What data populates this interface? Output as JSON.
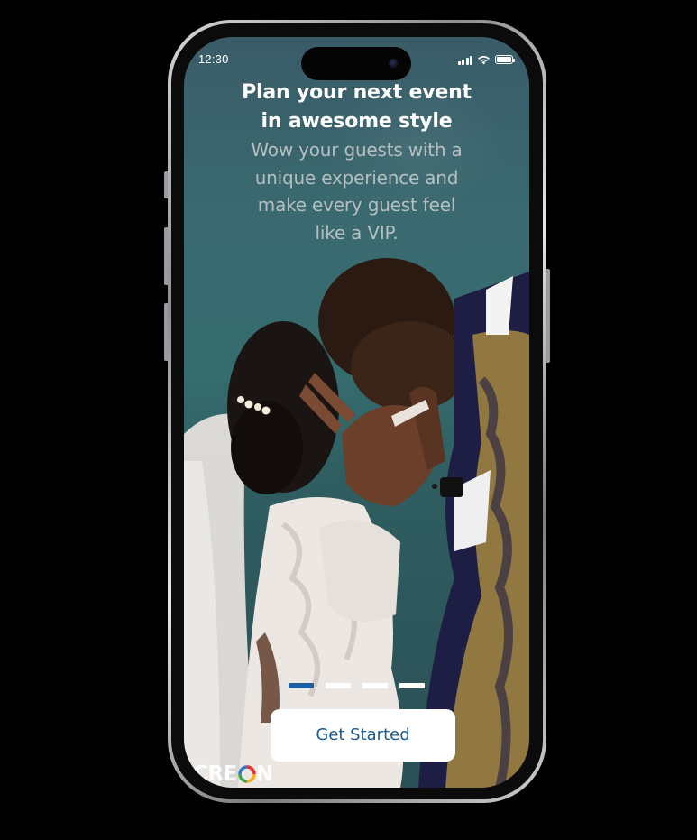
{
  "status_bar": {
    "time": "12:30"
  },
  "onboarding": {
    "headline_line1": "Plan your next event",
    "headline_line2": "in awesome style",
    "subtext_line1": "Wow your guests with a",
    "subtext_line2": "unique experience and",
    "subtext_line3": "make every guest feel",
    "subtext_line4": "like a VIP.",
    "pager": {
      "total_pages": 4,
      "active_page": 1
    },
    "cta_label": "Get Started"
  },
  "watermark": {
    "logo_prefix": "CRE",
    "logo_suffix": "N"
  },
  "colors": {
    "accent_blue": "#1d5a8c",
    "active_dot": "#1b5fa3",
    "background_teal": "#356c6e"
  },
  "icons": [
    "cellular-signal-icon",
    "wifi-icon",
    "battery-icon",
    "front-camera-icon"
  ]
}
